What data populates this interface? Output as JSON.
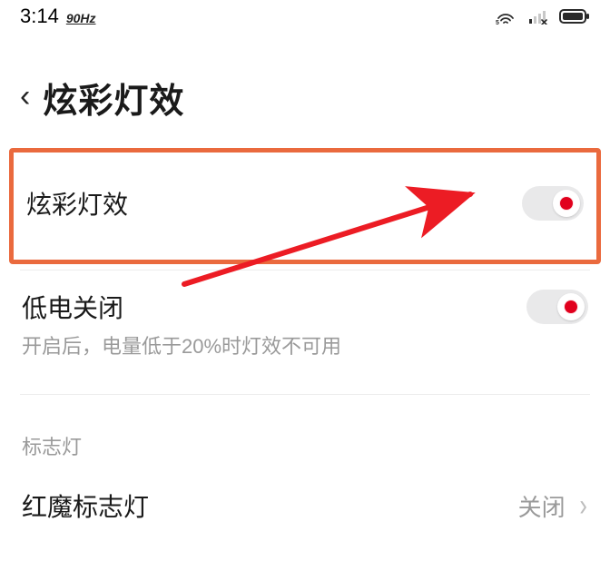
{
  "status": {
    "time": "3:14",
    "refresh_rate": "90Hz"
  },
  "header": {
    "title": "炫彩灯效"
  },
  "rows": {
    "light_effect": {
      "label": "炫彩灯效",
      "toggle_on": true
    },
    "low_battery_off": {
      "label": "低电关闭",
      "sub": "开启后，电量低于20%时灯效不可用",
      "toggle_on": true
    }
  },
  "section": {
    "title": "标志灯",
    "logo_light": {
      "label": "红魔标志灯",
      "value": "关闭"
    }
  }
}
